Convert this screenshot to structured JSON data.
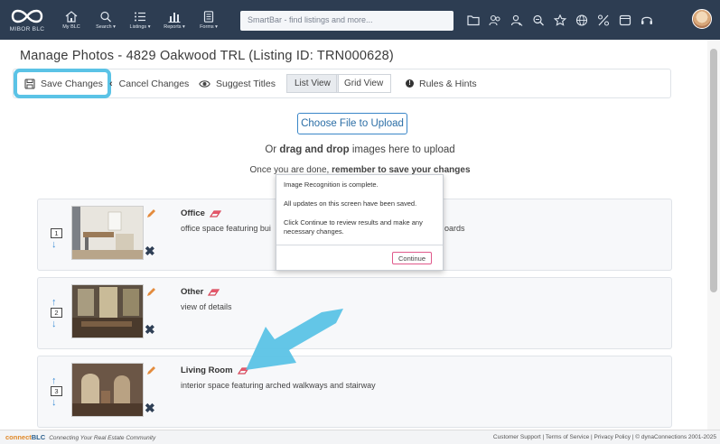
{
  "brand": {
    "name": "MIBOR BLC",
    "colors": {
      "topbar": "#2d3d52",
      "highlight": "#5bc3e6",
      "link": "#3a86c8"
    }
  },
  "nav": [
    {
      "label": "My BLC",
      "icon": "home-icon"
    },
    {
      "label": "Search ▾",
      "icon": "search-icon"
    },
    {
      "label": "Listings ▾",
      "icon": "list-icon"
    },
    {
      "label": "Reports ▾",
      "icon": "bar-chart-icon"
    },
    {
      "label": "Forms ▾",
      "icon": "document-icon"
    }
  ],
  "smartbar": {
    "placeholder": "SmartBar - find listings and more..."
  },
  "top_icons": [
    "folder-icon",
    "contacts-icon",
    "user-search-icon",
    "zoom-icon",
    "star-icon",
    "globe-icon",
    "percent-icon",
    "window-icon",
    "headset-icon"
  ],
  "page": {
    "title": "Manage Photos - 4829 Oakwood TRL (Listing ID: TRN000628)"
  },
  "toolbar": {
    "save": "Save Changes",
    "cancel": "Cancel Changes",
    "suggest": "Suggest Titles",
    "list_view": "List View",
    "grid_view": "Grid View",
    "rules": "Rules & Hints"
  },
  "upload": {
    "button": "Choose File to Upload",
    "drag_prefix": "Or ",
    "drag_bold": "drag and drop",
    "drag_suffix": " images here to upload",
    "once_prefix": "Once you are done, ",
    "once_bold": "remember to save your changes"
  },
  "photos": [
    {
      "number": "1",
      "title": "Office",
      "description": "office space featuring bui",
      "description_tail": "oards"
    },
    {
      "number": "2",
      "title": "Other",
      "description": "view of details"
    },
    {
      "number": "3",
      "title": "Living Room",
      "description": "interior space featuring arched walkways and stairway"
    }
  ],
  "modal": {
    "line1": "Image Recognition is complete.",
    "line2": "All updates on this screen have been saved.",
    "line3": "Click Continue to review results and make any necessary changes.",
    "button": "Continue"
  },
  "footer": {
    "brand_c": "connect",
    "brand_rest": "BLC",
    "tagline": "Connecting Your Real Estate Community",
    "links": "Customer Support | Terms of Service | Privacy Policy | © dynaConnections 2001-2025"
  }
}
